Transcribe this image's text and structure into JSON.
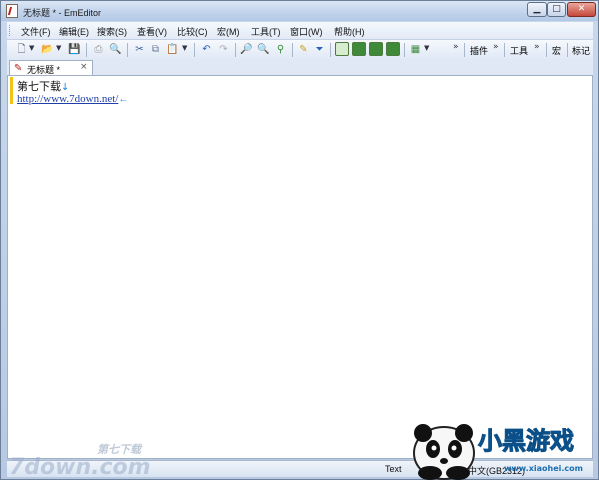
{
  "window": {
    "title": "无标题 * - EmEditor"
  },
  "menu": [
    "文件(F)",
    "编辑(E)",
    "搜索(S)",
    "查看(V)",
    "比较(C)",
    "宏(M)",
    "工具(T)",
    "窗口(W)",
    "帮助(H)"
  ],
  "toolbar": {
    "chevron": "»",
    "plugin_label": "插件",
    "tools_label": "工具",
    "macro_label": "宏",
    "mark_label": "标记"
  },
  "tab": {
    "label": "无标题 *",
    "close": "×"
  },
  "editor": {
    "line1": "第七下载",
    "line2_url": "http://www.7down.net/",
    "eol_line1": "↓",
    "eol_line2": "←"
  },
  "status": {
    "mode": "Text",
    "encoding": "体中文(GB2312)"
  },
  "watermark_left": {
    "brand": "第七下载",
    "domain": "7down.com"
  },
  "watermark_right": {
    "brand": "小黑游戏",
    "domain": "www.xiaohei.com"
  },
  "colors": {
    "title_gradient_top": "#dbe6f4",
    "close_button": "#c5473a",
    "url": "#1f3ea8",
    "eol_marker": "#1b87d6",
    "mark_bar": "#f0c419"
  }
}
